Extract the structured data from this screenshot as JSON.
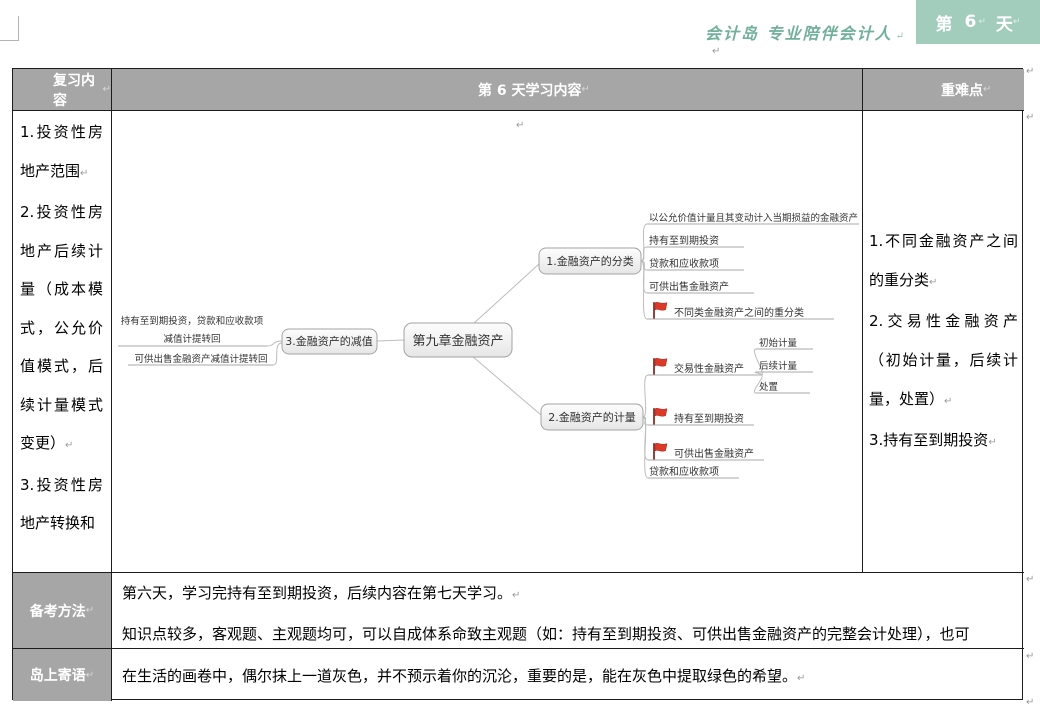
{
  "marks": {
    "pilcrow": "↵"
  },
  "header": {
    "brand": "会计岛 专业陪伴会计人",
    "badge": {
      "prefix": "第",
      "number": "6",
      "suffix": "天"
    }
  },
  "table": {
    "headers": {
      "review": "复习内容",
      "study": "第 6 天学习内容",
      "key_points": "重难点"
    },
    "review": {
      "p1": "1.投资性房地产范围",
      "p2": "2.投资性房地产后续计量（成本模式，公允价值模式，后续计量模式变更）",
      "p3": "3.投资性房地产转换和"
    },
    "key_points": {
      "p1": "1.不同金融资产之间的重分类",
      "p2": "2.交易性金融资产（初始计量，后续计量，处置）",
      "p3": "3.持有至到期投资"
    },
    "prep": {
      "label": "备考方法",
      "p1": "第六天，学习完持有至到期投资，后续内容在第七天学习。",
      "p2": "知识点较多，客观题、主观题均可，可以自成体系命致主观题（如：持有至到期投资、可供出售金融资产的完整会计处理），也可"
    },
    "island": {
      "label": "岛上寄语",
      "text": "在生活的画卷中，偶尔抹上一道灰色，并不预示着你的沉沦，重要的是，能在灰色中提取绿色的希望。"
    }
  },
  "mindmap": {
    "root": "第九章金融资产",
    "classification": {
      "label": "1.金融资产的分类",
      "c1": "以公允价值计量且其变动计入当期损益的金融资产",
      "c2": "持有至到期投资",
      "c3": "贷款和应收款项",
      "c4": "可供出售金融资产",
      "c5": "不同类金融资产之间的重分类"
    },
    "measurement": {
      "label": "2.金融资产的计量",
      "c1": "交易性金融资产",
      "c1_1": "初始计量",
      "c1_2": "后续计量",
      "c1_3": "处置",
      "c2": "持有至到期投资",
      "c3": "可供出售金融资产",
      "c4": "贷款和应收款项"
    },
    "impairment": {
      "label": "3.金融资产的减值",
      "c1_line1": "持有至到期投资，贷款和应收款项",
      "c1_line2": "减值计提转回",
      "c2": "可供出售金融资产减值计提转回"
    }
  },
  "colors": {
    "accent_teal": "#a2ccbc",
    "header_gray": "#a6a6a6",
    "flag_red": "#dc3a28",
    "connector_gray": "#bdbdbd"
  }
}
